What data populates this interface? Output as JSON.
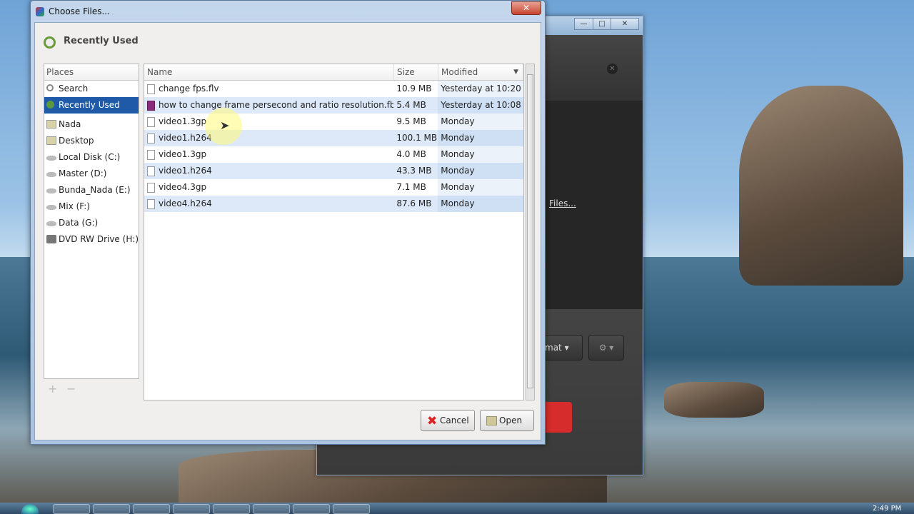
{
  "dialog": {
    "title": "Choose Files...",
    "location_header": "Recently Used",
    "places_header": "Places",
    "places": [
      {
        "label": "Search",
        "icon": "search-icon"
      },
      {
        "label": "Recently Used",
        "icon": "recent-icon",
        "selected": true
      },
      {
        "label": "Nada",
        "icon": "folder-icon"
      },
      {
        "label": "Desktop",
        "icon": "folder-icon"
      },
      {
        "label": "Local Disk (C:)",
        "icon": "drive-icon"
      },
      {
        "label": "Master (D:)",
        "icon": "drive-icon"
      },
      {
        "label": "Bunda_Nada (E:)",
        "icon": "drive-icon"
      },
      {
        "label": "Mix (F:)",
        "icon": "drive-icon"
      },
      {
        "label": "Data (G:)",
        "icon": "drive-icon"
      },
      {
        "label": "DVD RW Drive (H:)",
        "icon": "dvd-icon"
      }
    ],
    "columns": {
      "name": "Name",
      "size": "Size",
      "modified": "Modified"
    },
    "files": [
      {
        "name": "change fps.flv",
        "size": "10.9 MB",
        "modified": "Yesterday at 10:20"
      },
      {
        "name": "how to change frame persecond and ratio resolution.fbr",
        "size": "5.4 MB",
        "modified": "Yesterday at 10:08"
      },
      {
        "name": "video1.3gp",
        "size": "9.5 MB",
        "modified": "Monday"
      },
      {
        "name": "video1.h264",
        "size": "100.1 MB",
        "modified": "Monday"
      },
      {
        "name": "video1.3gp",
        "size": "4.0 MB",
        "modified": "Monday"
      },
      {
        "name": "video1.h264",
        "size": "43.3 MB",
        "modified": "Monday"
      },
      {
        "name": "video4.3gp",
        "size": "7.1 MB",
        "modified": "Monday"
      },
      {
        "name": "video4.h264",
        "size": "87.6 MB",
        "modified": "Monday"
      }
    ],
    "add_label": "+",
    "remove_label": "−",
    "cancel_label": "Cancel",
    "open_label": "Open"
  },
  "background_app": {
    "files_link": "Files...",
    "format_button": "mat ▾",
    "gear_arrow": "▾"
  },
  "taskbar": {
    "clock": "2:49 PM"
  },
  "colors": {
    "selection": "#1e5aa8",
    "red_button": "#d62c2c"
  }
}
